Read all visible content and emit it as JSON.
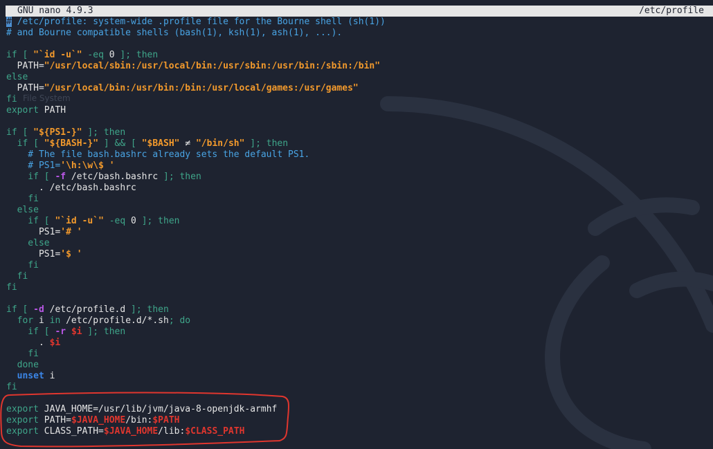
{
  "window": {
    "app_title": "GNU nano 4.9.3",
    "file_name": "/etc/profile"
  },
  "background": {
    "ghost_label": "File System"
  },
  "colors": {
    "background": "#1e2330",
    "title_bar": "#e6e6e6",
    "comment": "#49a4e4",
    "keyword": "#3fa68a",
    "string": "#f39a2c",
    "variable": "#e0362e",
    "flag": "#b957e6",
    "builtin": "#3b86e8",
    "annotation": "#e0362e"
  },
  "lines": [
    [
      [
        "cursor",
        "#"
      ],
      [
        "cm",
        " /etc/profile: system-wide .profile file for the Bourne shell (sh(1))"
      ]
    ],
    [
      [
        "cm",
        "# and Bourne compatible shells (bash(1), ksh(1), ash(1), ...)."
      ]
    ],
    [],
    [
      [
        "kw",
        "if [ "
      ],
      [
        "st",
        "\"`id -u`\""
      ],
      [
        "kw",
        " -eq "
      ],
      [
        "pl",
        "0"
      ],
      [
        "kw",
        " ]; then"
      ]
    ],
    [
      [
        "pl",
        "  PATH="
      ],
      [
        "st",
        "\"/usr/local/sbin:/usr/local/bin:/usr/sbin:/usr/bin:/sbin:/bin\""
      ]
    ],
    [
      [
        "kw",
        "else"
      ]
    ],
    [
      [
        "pl",
        "  PATH="
      ],
      [
        "st",
        "\"/usr/local/bin:/usr/bin:/bin:/usr/local/games:/usr/games\""
      ]
    ],
    [
      [
        "kw",
        "fi"
      ]
    ],
    [
      [
        "kw",
        "export"
      ],
      [
        "pl",
        " PATH"
      ]
    ],
    [],
    [
      [
        "kw",
        "if [ "
      ],
      [
        "st",
        "\"${PS1-}\""
      ],
      [
        "kw",
        " ]; then"
      ]
    ],
    [
      [
        "kw",
        "  if [ "
      ],
      [
        "st",
        "\"${BASH-}\""
      ],
      [
        "kw",
        " ] && [ "
      ],
      [
        "st",
        "\"$BASH\""
      ],
      [
        "pl",
        " ≠ "
      ],
      [
        "st",
        "\"/bin/sh\""
      ],
      [
        "kw",
        " ]; then"
      ]
    ],
    [
      [
        "cm",
        "    # The file bash.bashrc already sets the default PS1."
      ]
    ],
    [
      [
        "cm",
        "    # PS1="
      ],
      [
        "st",
        "'\\h:\\w\\$ '"
      ]
    ],
    [
      [
        "kw",
        "    if [ "
      ],
      [
        "fl",
        "-f"
      ],
      [
        "pl",
        " /etc/bash.bashrc"
      ],
      [
        "kw",
        " ]; then"
      ]
    ],
    [
      [
        "pl",
        "      . /etc/bash.bashrc"
      ]
    ],
    [
      [
        "kw",
        "    fi"
      ]
    ],
    [
      [
        "kw",
        "  else"
      ]
    ],
    [
      [
        "kw",
        "    if [ "
      ],
      [
        "st",
        "\"`id -u`\""
      ],
      [
        "kw",
        " -eq "
      ],
      [
        "pl",
        "0"
      ],
      [
        "kw",
        " ]; then"
      ]
    ],
    [
      [
        "pl",
        "      PS1="
      ],
      [
        "st",
        "'# '"
      ]
    ],
    [
      [
        "kw",
        "    else"
      ]
    ],
    [
      [
        "pl",
        "      PS1="
      ],
      [
        "st",
        "'$ '"
      ]
    ],
    [
      [
        "kw",
        "    fi"
      ]
    ],
    [
      [
        "kw",
        "  fi"
      ]
    ],
    [
      [
        "kw",
        "fi"
      ]
    ],
    [],
    [
      [
        "kw",
        "if [ "
      ],
      [
        "fl",
        "-d"
      ],
      [
        "pl",
        " /etc/profile.d"
      ],
      [
        "kw",
        " ]; then"
      ]
    ],
    [
      [
        "kw",
        "  for "
      ],
      [
        "pl",
        "i"
      ],
      [
        "kw",
        " in "
      ],
      [
        "pl",
        "/etc/profile.d/*.sh"
      ],
      [
        "kw",
        "; do"
      ]
    ],
    [
      [
        "kw",
        "    if [ "
      ],
      [
        "fl",
        "-r"
      ],
      [
        "pl",
        " "
      ],
      [
        "vr",
        "$i"
      ],
      [
        "kw",
        " ]; then"
      ]
    ],
    [
      [
        "pl",
        "      . "
      ],
      [
        "vr",
        "$i"
      ]
    ],
    [
      [
        "kw",
        "    fi"
      ]
    ],
    [
      [
        "kw",
        "  done"
      ]
    ],
    [
      [
        "bl",
        "  unset"
      ],
      [
        "pl",
        " i"
      ]
    ],
    [
      [
        "kw",
        "fi"
      ]
    ],
    [],
    [
      [
        "kw",
        "export"
      ],
      [
        "pl",
        " JAVA_HOME=/usr/lib/jvm/java-8-openjdk-armhf"
      ]
    ],
    [
      [
        "kw",
        "export"
      ],
      [
        "pl",
        " PATH="
      ],
      [
        "vr",
        "$JAVA_HOME"
      ],
      [
        "pl",
        "/bin:"
      ],
      [
        "vr",
        "$PATH"
      ]
    ],
    [
      [
        "kw",
        "export"
      ],
      [
        "pl",
        " CLASS_PATH="
      ],
      [
        "vr",
        "$JAVA_HOME"
      ],
      [
        "pl",
        "/lib:"
      ],
      [
        "vr",
        "$CLASS_PATH"
      ]
    ]
  ]
}
